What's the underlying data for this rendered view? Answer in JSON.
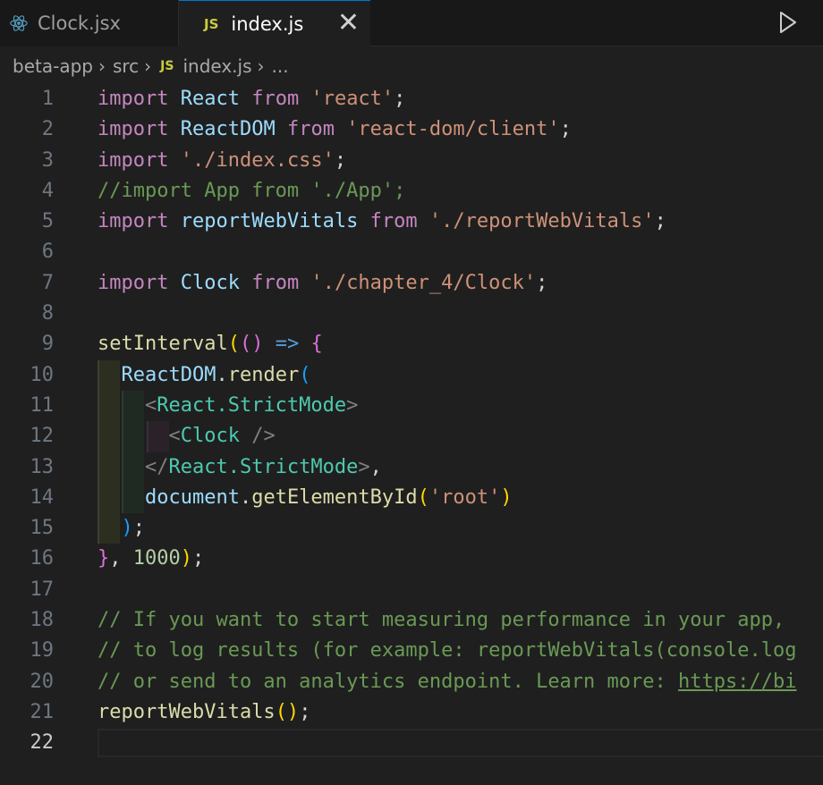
{
  "tabs": [
    {
      "label": "Clock.jsx",
      "icon": "react-icon",
      "active": false
    },
    {
      "label": "index.js",
      "icon": "js-icon",
      "active": true
    }
  ],
  "js_badge": "JS",
  "close_glyph": "✕",
  "breadcrumb": [
    "beta-app",
    "src",
    "index.js",
    "..."
  ],
  "line_numbers": [
    "1",
    "2",
    "3",
    "4",
    "5",
    "6",
    "7",
    "8",
    "9",
    "10",
    "11",
    "12",
    "13",
    "14",
    "15",
    "16",
    "17",
    "18",
    "19",
    "20",
    "21",
    "22"
  ],
  "active_line": 22,
  "code": {
    "l1": [
      "import",
      "React",
      "from",
      "'react'",
      ";"
    ],
    "l2": [
      "import",
      "ReactDOM",
      "from",
      "'react-dom/client'",
      ";"
    ],
    "l3": [
      "import",
      "'./index.css'",
      ";"
    ],
    "l4": "//import App from './App';",
    "l5": [
      "import",
      "reportWebVitals",
      "from",
      "'./reportWebVitals'",
      ";"
    ],
    "l7": [
      "import",
      "Clock",
      "from",
      "'./chapter_4/Clock'",
      ";"
    ],
    "l9": [
      "setInterval",
      "(",
      "()",
      "=>",
      "{"
    ],
    "l10": [
      "ReactDOM",
      ".",
      "render",
      "("
    ],
    "l11": [
      "<",
      "React.StrictMode",
      ">"
    ],
    "l12": [
      "<",
      "Clock",
      "/>"
    ],
    "l13": [
      "</",
      "React.StrictMode",
      ">",
      ","
    ],
    "l14": [
      "document",
      ".",
      "getElementById",
      "(",
      "'root'",
      ")"
    ],
    "l15": [
      ")",
      ";"
    ],
    "l16": [
      "}",
      ",",
      "1000",
      ")",
      ";"
    ],
    "l18": "// If you want to start measuring performance in your app,",
    "l19": "// to log results (for example: reportWebVitals(console.log",
    "l20_text": "// or send to an analytics endpoint. Learn more: ",
    "l20_link": "https://bi",
    "l21": [
      "reportWebVitals",
      "()",
      ";"
    ]
  }
}
